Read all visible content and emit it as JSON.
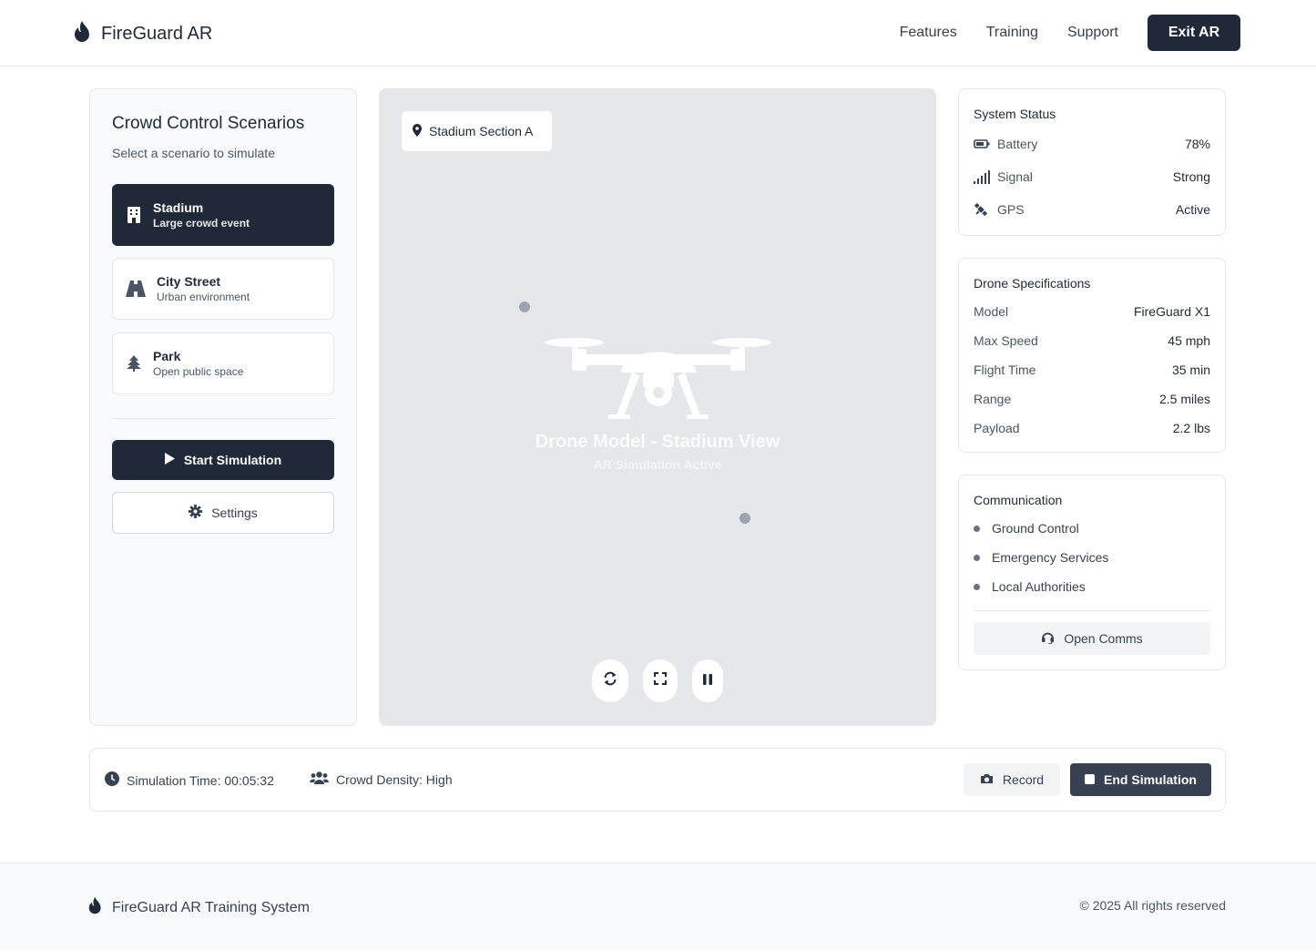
{
  "header": {
    "brand": "FireGuard AR",
    "nav": [
      "Features",
      "Training",
      "Support"
    ],
    "exit_label": "Exit AR"
  },
  "scenarios_panel": {
    "title": "Crowd Control Scenarios",
    "subtitle": "Select a scenario to simulate",
    "items": [
      {
        "name": "Stadium",
        "desc": "Large crowd event",
        "icon": "building-icon",
        "active": true
      },
      {
        "name": "City Street",
        "desc": "Urban environment",
        "icon": "road-icon",
        "active": false
      },
      {
        "name": "Park",
        "desc": "Open public space",
        "icon": "tree-icon",
        "active": false
      }
    ],
    "start_label": "Start Simulation",
    "settings_label": "Settings"
  },
  "viewport": {
    "location": "Stadium Section A",
    "title": "Drone Model - Stadium View",
    "subtitle": "AR Simulation Active"
  },
  "system_status": {
    "title": "System Status",
    "rows": [
      {
        "label": "Battery",
        "value": "78%",
        "icon": "battery-icon"
      },
      {
        "label": "Signal",
        "value": "Strong",
        "icon": "signal-icon"
      },
      {
        "label": "GPS",
        "value": "Active",
        "icon": "satellite-icon"
      }
    ]
  },
  "drone_specs": {
    "title": "Drone Specifications",
    "rows": [
      {
        "label": "Model",
        "value": "FireGuard X1"
      },
      {
        "label": "Max Speed",
        "value": "45 mph"
      },
      {
        "label": "Flight Time",
        "value": "35 min"
      },
      {
        "label": "Range",
        "value": "2.5 miles"
      },
      {
        "label": "Payload",
        "value": "2.2 lbs"
      }
    ]
  },
  "communication": {
    "title": "Communication",
    "items": [
      "Ground Control",
      "Emergency Services",
      "Local Authorities"
    ],
    "open_label": "Open Comms"
  },
  "bottom_bar": {
    "time": "Simulation Time: 00:05:32",
    "density": "Crowd Density: High",
    "record_label": "Record",
    "end_label": "End Simulation"
  },
  "footer": {
    "brand": "FireGuard AR Training System",
    "copyright": "© 2025 All rights reserved"
  },
  "colors": {
    "primary": "#1f2937",
    "viewport_bg": "#e5e7eb",
    "muted": "#4b5563"
  }
}
